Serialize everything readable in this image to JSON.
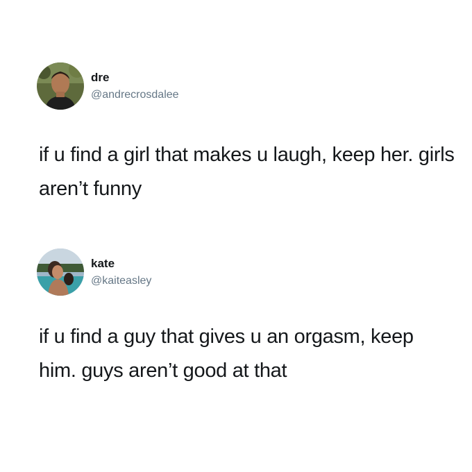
{
  "tweets": [
    {
      "name": "dre",
      "handle": "@andrecrosdalee",
      "avatar_icon": "avatar-photo-dre",
      "text": "if u find a girl that makes u laugh, keep her. girls aren’t funny"
    },
    {
      "name": "kate",
      "handle": "@kaiteasley",
      "avatar_icon": "avatar-photo-kate",
      "text": "if u find a guy that gives u an orgasm, keep him. guys aren’t good at that"
    }
  ],
  "colors": {
    "background": "#ffffff",
    "text": "#14171a",
    "handle": "#657786"
  }
}
